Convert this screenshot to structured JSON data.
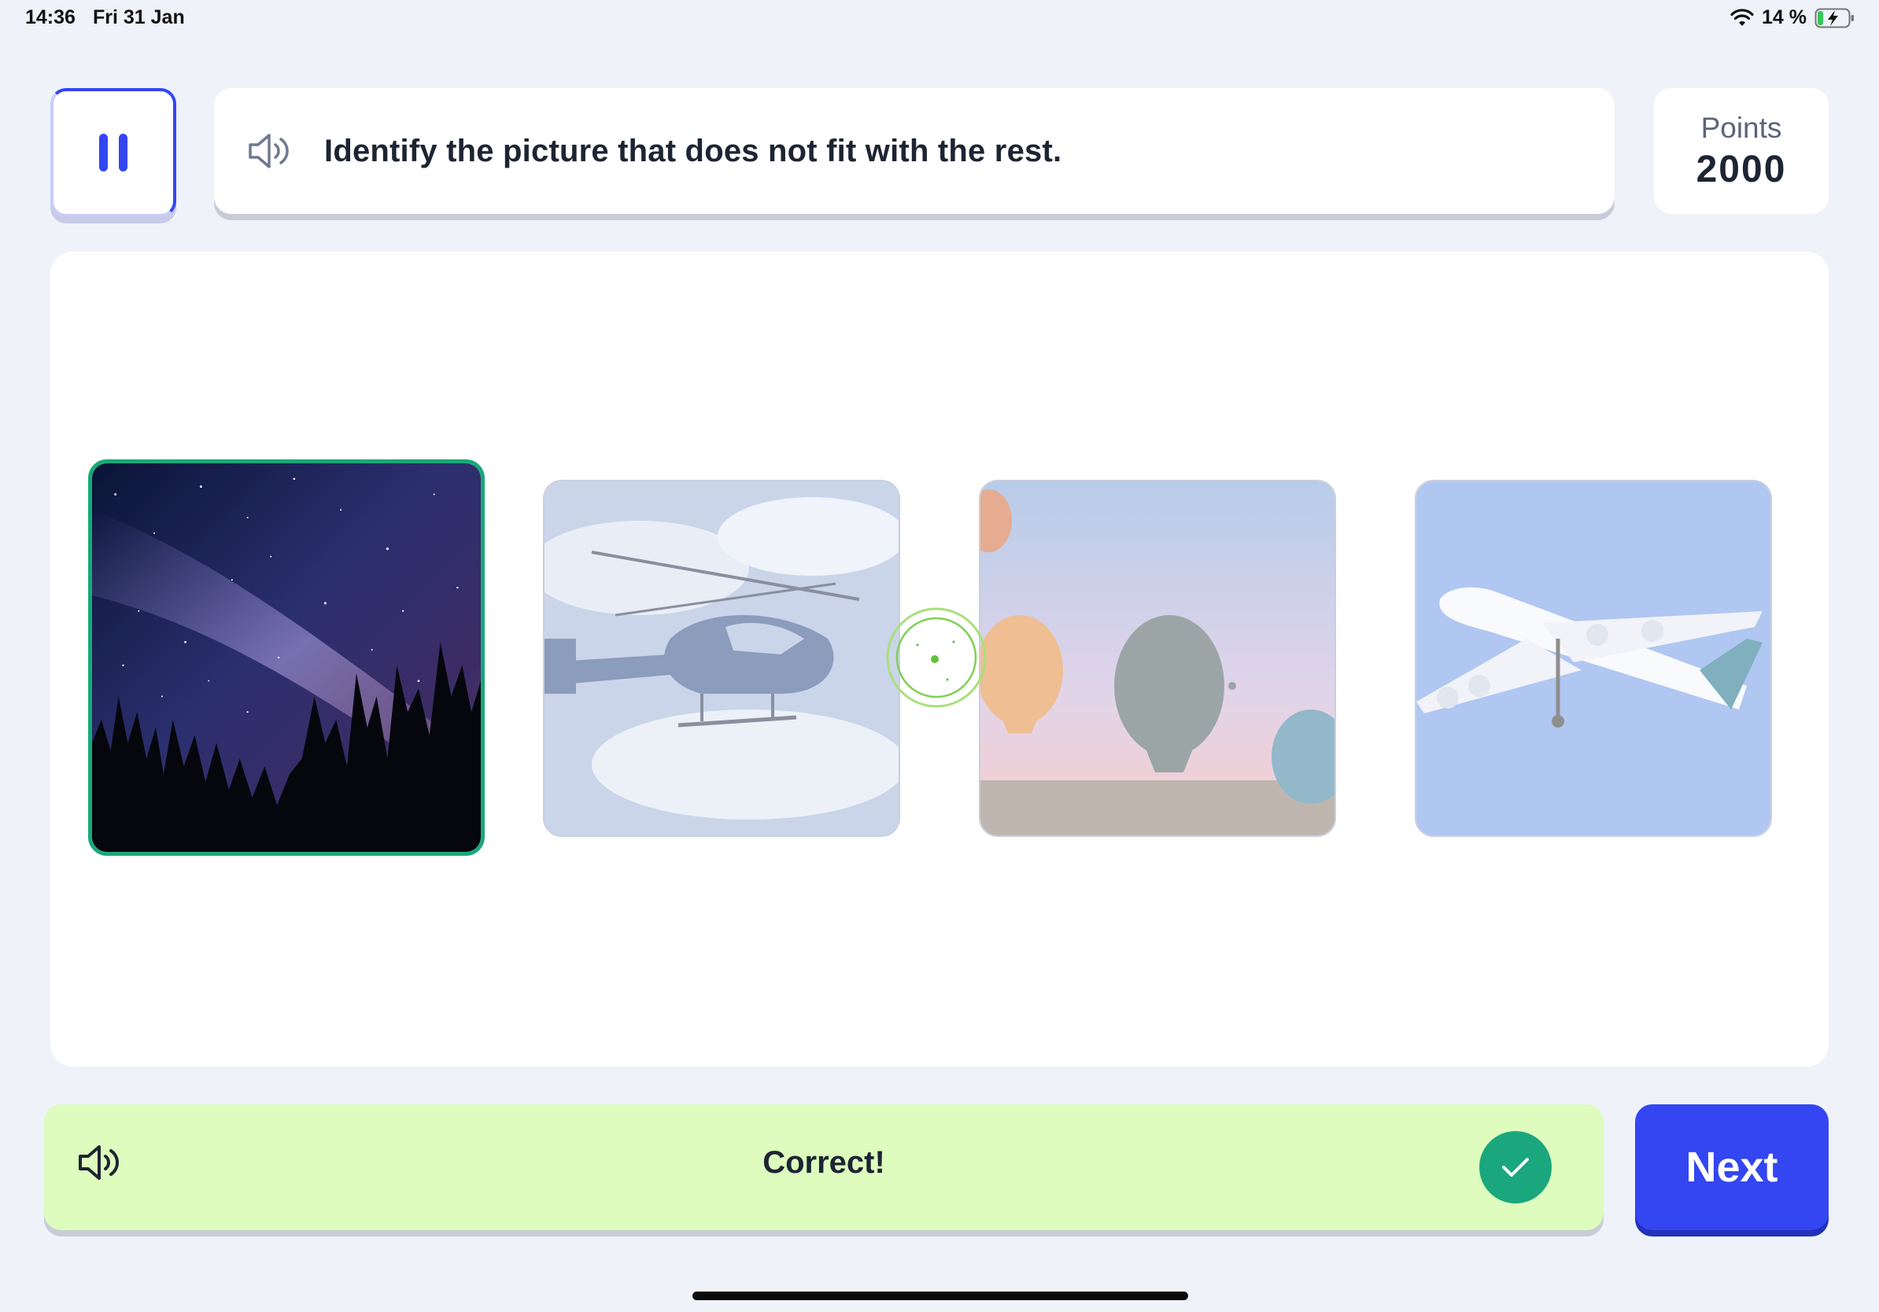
{
  "status_bar": {
    "time": "14:36",
    "date": "Fri 31 Jan",
    "battery": "14 %",
    "icons": [
      "wifi-icon",
      "battery-charging-icon"
    ]
  },
  "header": {
    "pause_icon": "pause-icon",
    "speaker_icon": "speaker-icon",
    "instruction": "Identify the picture that does not fit with the rest.",
    "points_label": "Points",
    "points_value": "2000"
  },
  "choices": [
    {
      "subject": "night sky with trees",
      "state": "selected"
    },
    {
      "subject": "helicopter",
      "state": "faded"
    },
    {
      "subject": "hot air balloons",
      "state": "faded"
    },
    {
      "subject": "airplane",
      "state": "faded"
    }
  ],
  "feedback": {
    "speaker_icon": "speaker-icon",
    "text": "Correct!",
    "check_icon": "checkmark-icon"
  },
  "next_label": "Next",
  "colors": {
    "accent": "#3346f2",
    "correct": "#1aa77d",
    "feedback_bg": "#ddfcbd",
    "page_bg": "#eff2f9"
  }
}
